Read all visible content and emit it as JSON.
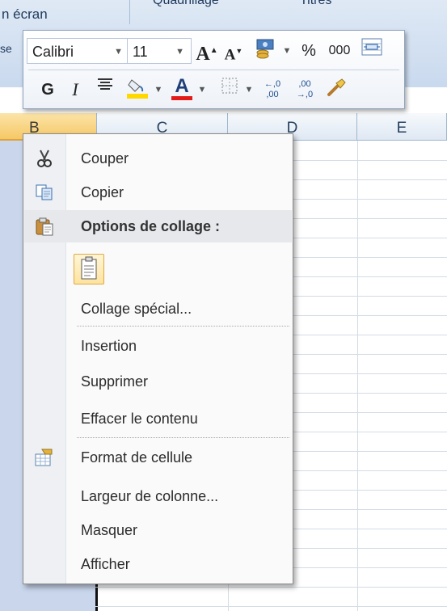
{
  "ribbon": {
    "text_top": "n écran",
    "text_side": "se",
    "group_label_1": "Quadrillage",
    "group_label_2": "Titres"
  },
  "columns": {
    "B": "B",
    "C": "C",
    "D": "D",
    "E": "E"
  },
  "mini_toolbar": {
    "font_name": "Calibri",
    "font_size": "11",
    "grow_font": "A",
    "shrink_font": "A",
    "percent": "%",
    "thousands": "000",
    "bold": "G",
    "italic": "I",
    "font_color_letter": "A",
    "increase_decimal": "←,0 ,00",
    "decrease_decimal": ",00 →,0"
  },
  "context_menu": {
    "items": [
      {
        "label": "Couper",
        "icon": "scissors-icon"
      },
      {
        "label": "Copier",
        "icon": "copy-icon"
      },
      {
        "label": "Options de collage :",
        "icon": "clipboard-icon"
      },
      {
        "label": "Collage spécial...",
        "icon": ""
      },
      {
        "label": "Insertion",
        "icon": ""
      },
      {
        "label": "Supprimer",
        "icon": ""
      },
      {
        "label": "Effacer le contenu",
        "icon": ""
      },
      {
        "label": "Format de cellule",
        "icon": "format-cells-icon"
      },
      {
        "label": "Largeur de colonne...",
        "icon": ""
      },
      {
        "label": "Masquer",
        "icon": ""
      },
      {
        "label": "Afficher",
        "icon": ""
      }
    ]
  },
  "colors": {
    "selected_header": "#f6c866",
    "menu_highlight": "#e6e8ec",
    "ribbon": "#dfe9f5"
  }
}
